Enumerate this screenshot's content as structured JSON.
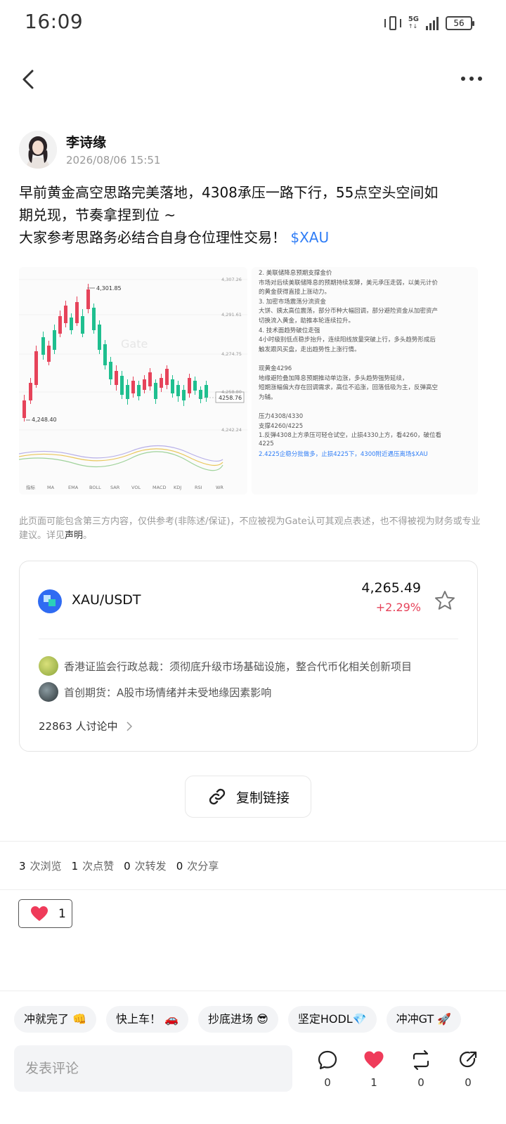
{
  "status_bar": {
    "time": "16:09",
    "network": "5G",
    "battery": "56"
  },
  "post": {
    "author": "李诗缘",
    "time": "2026/08/06 15:51",
    "text_line1": "早前黄金高空思路完美落地，4308承压一路下行，55点空头空间如",
    "text_line2": "期兑现，节奏拿捏到位 ~",
    "text_line3": "大家参考思路务必结合自身仓位理性交易！",
    "tag": "$XAU"
  },
  "chart_image": {
    "high_label": "4,301.85",
    "low_label": "4,248.40",
    "current_label": "4258.76",
    "axis_labels": [
      "4,307.26",
      "4,291.61",
      "4,274.75",
      "4,258.80",
      "4,242.24"
    ],
    "indicator_tabs": [
      "指标",
      "MA",
      "EMA",
      "BOLL",
      "SAR",
      "VOL",
      "MACD",
      "KDJ",
      "RSI",
      "WR"
    ],
    "watermark": "Gate"
  },
  "analysis_image": {
    "lines": [
      "2. 美联储降息预期支撑金价",
      "市场对后续美联储降息的预期持续发酵，美元承压走弱，以美元计价",
      "的黄金获得直接上涨动力。",
      "3. 加密市场震荡分流资金",
      "大饼、姨太高位震荡，部分币种大幅回调，部分避险资金从加密资产",
      "切换流入黄金，助推本轮连续拉升。",
      "4. 技术面趋势破位走强",
      "4小时级别低点稳步抬升，连续阳线放量突破上行，多头趋势形成后",
      "触发跟风买盘，走出趋势性上涨行情。",
      "",
      "现黄金4296",
      "地缘避险叠加降息预期推动单边涨，多头趋势强势延续，",
      "短期涨幅偏大存在回调需求，高位不追涨，回落低吸为主，反弹高空",
      "为辅。",
      "",
      "压力4308/4330",
      "支撑4260/4225",
      "1.反弹4308上方承压可轻仓试空，止损4330上方，看4260，破位看",
      "4225",
      "2.4225企稳分批做多，止损4225下，4300附近遇压离场$XAU"
    ]
  },
  "disclaimer": {
    "text": "此页面可能包含第三方内容，仅供参考(非陈述/保证)，不应被视为Gate认可其观点表述，也不得被视为财务或专业建议。详见",
    "link": "声明",
    "end": "。"
  },
  "market_card": {
    "pair": "XAU/USDT",
    "price": "4,265.49",
    "change": "+2.29%",
    "news": [
      "香港证监会行政总裁：须彻底升级市场基础设施，整合代币化相关创新项目",
      "首创期货：A股市场情绪并未受地缘因素影响"
    ],
    "discussion": "22863 人讨论中"
  },
  "copy_link": "复制链接",
  "stats": [
    {
      "n": "3",
      "label": "次浏览"
    },
    {
      "n": "1",
      "label": "次点赞"
    },
    {
      "n": "0",
      "label": "次转发"
    },
    {
      "n": "0",
      "label": "次分享"
    }
  ],
  "reaction": {
    "count": "1"
  },
  "quick_replies": [
    "冲就完了 👊",
    "快上车！ 🚗",
    "抄底进场 😎",
    "坚定HODL💎",
    "冲冲GT 🚀"
  ],
  "comment_placeholder": "发表评论",
  "actions": {
    "comment": "0",
    "like": "1",
    "repost": "0",
    "share": "0"
  },
  "colors": {
    "accent": "#2f7df6",
    "down": "#e6435a",
    "up": "#1fbf8f",
    "like": "#ef3b5a"
  }
}
